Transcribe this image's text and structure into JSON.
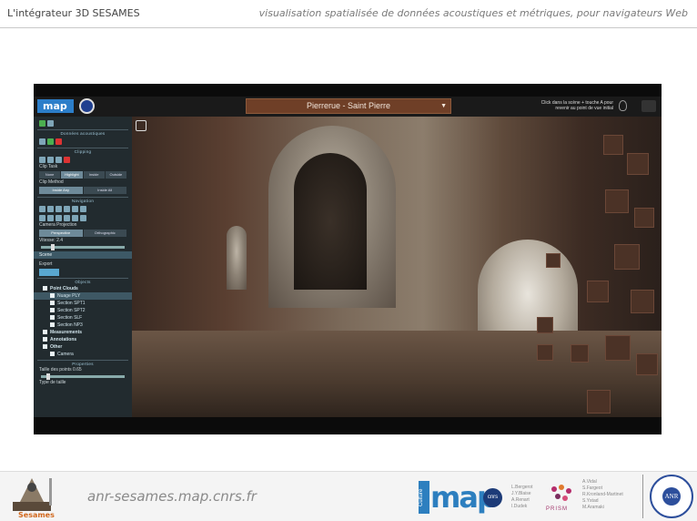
{
  "slide": {
    "title": "L'intégrateur 3D SESAMES",
    "subtitle": "visualisation spatialisée de données acoustiques et métriques, pour navigateurs Web"
  },
  "app": {
    "logo": "map",
    "scene_selector": "Pierrerue - Saint Pierre",
    "hint": "Click dans la scène + touche A pour revenir au point de vue initial",
    "sidebar": {
      "acoustic_section": "Données acoustiques",
      "clipping_section": "Clipping",
      "clip_task_label": "Clip Task",
      "clip_task_buttons": [
        "None",
        "Highlight",
        "Inside",
        "Outside"
      ],
      "clip_task_active": "Highlight",
      "clip_method_label": "Clip Method",
      "clip_method_buttons": [
        "Inside Any",
        "Inside All"
      ],
      "clip_method_active": "Inside Any",
      "navigation_section": "Navigation",
      "camera_projection_label": "Camera Projection",
      "camera_projection_buttons": [
        "Perspective",
        "Orthographic"
      ],
      "camera_projection_active": "Perspective",
      "speed_label": "Vitesse: 2.4",
      "speed_value": 0.12,
      "scene_band": "Scene",
      "export_label": "Export",
      "objects_section": "Objects",
      "tree": [
        {
          "label": "Point Clouds",
          "level": 0,
          "bold": true
        },
        {
          "label": "Nuage PLY",
          "level": 1,
          "selected": true
        },
        {
          "label": "Section SPT1",
          "level": 1
        },
        {
          "label": "Section SPT2",
          "level": 1
        },
        {
          "label": "Section SLF",
          "level": 1
        },
        {
          "label": "Section NP3",
          "level": 1
        },
        {
          "label": "Measurements",
          "level": 0,
          "bold": true
        },
        {
          "label": "Annotations",
          "level": 0,
          "bold": true
        },
        {
          "label": "Other",
          "level": 0,
          "bold": true
        },
        {
          "label": "Camera",
          "level": 1
        }
      ],
      "properties_section": "Properties",
      "point_size_label": "Taille des points 0.65",
      "point_type_label": "Type de taille"
    }
  },
  "footer": {
    "sesames_label": "Sesames",
    "url": "anr-sesames.map.cnrs.fr",
    "culture_label": "Culture",
    "map_label": "map",
    "cnrs_label": "cnrs",
    "names_map": [
      "L.Bergerot",
      "J.Y.Blaise",
      "A.Renart",
      "I.Dudek"
    ],
    "prism_label": "PRISM",
    "names_prism": [
      "A.Vidal",
      "S.Fargeot",
      "R.Kronland-Martinet",
      "S.Ystad",
      "M.Aramaki"
    ],
    "anr_label": "ANR"
  }
}
